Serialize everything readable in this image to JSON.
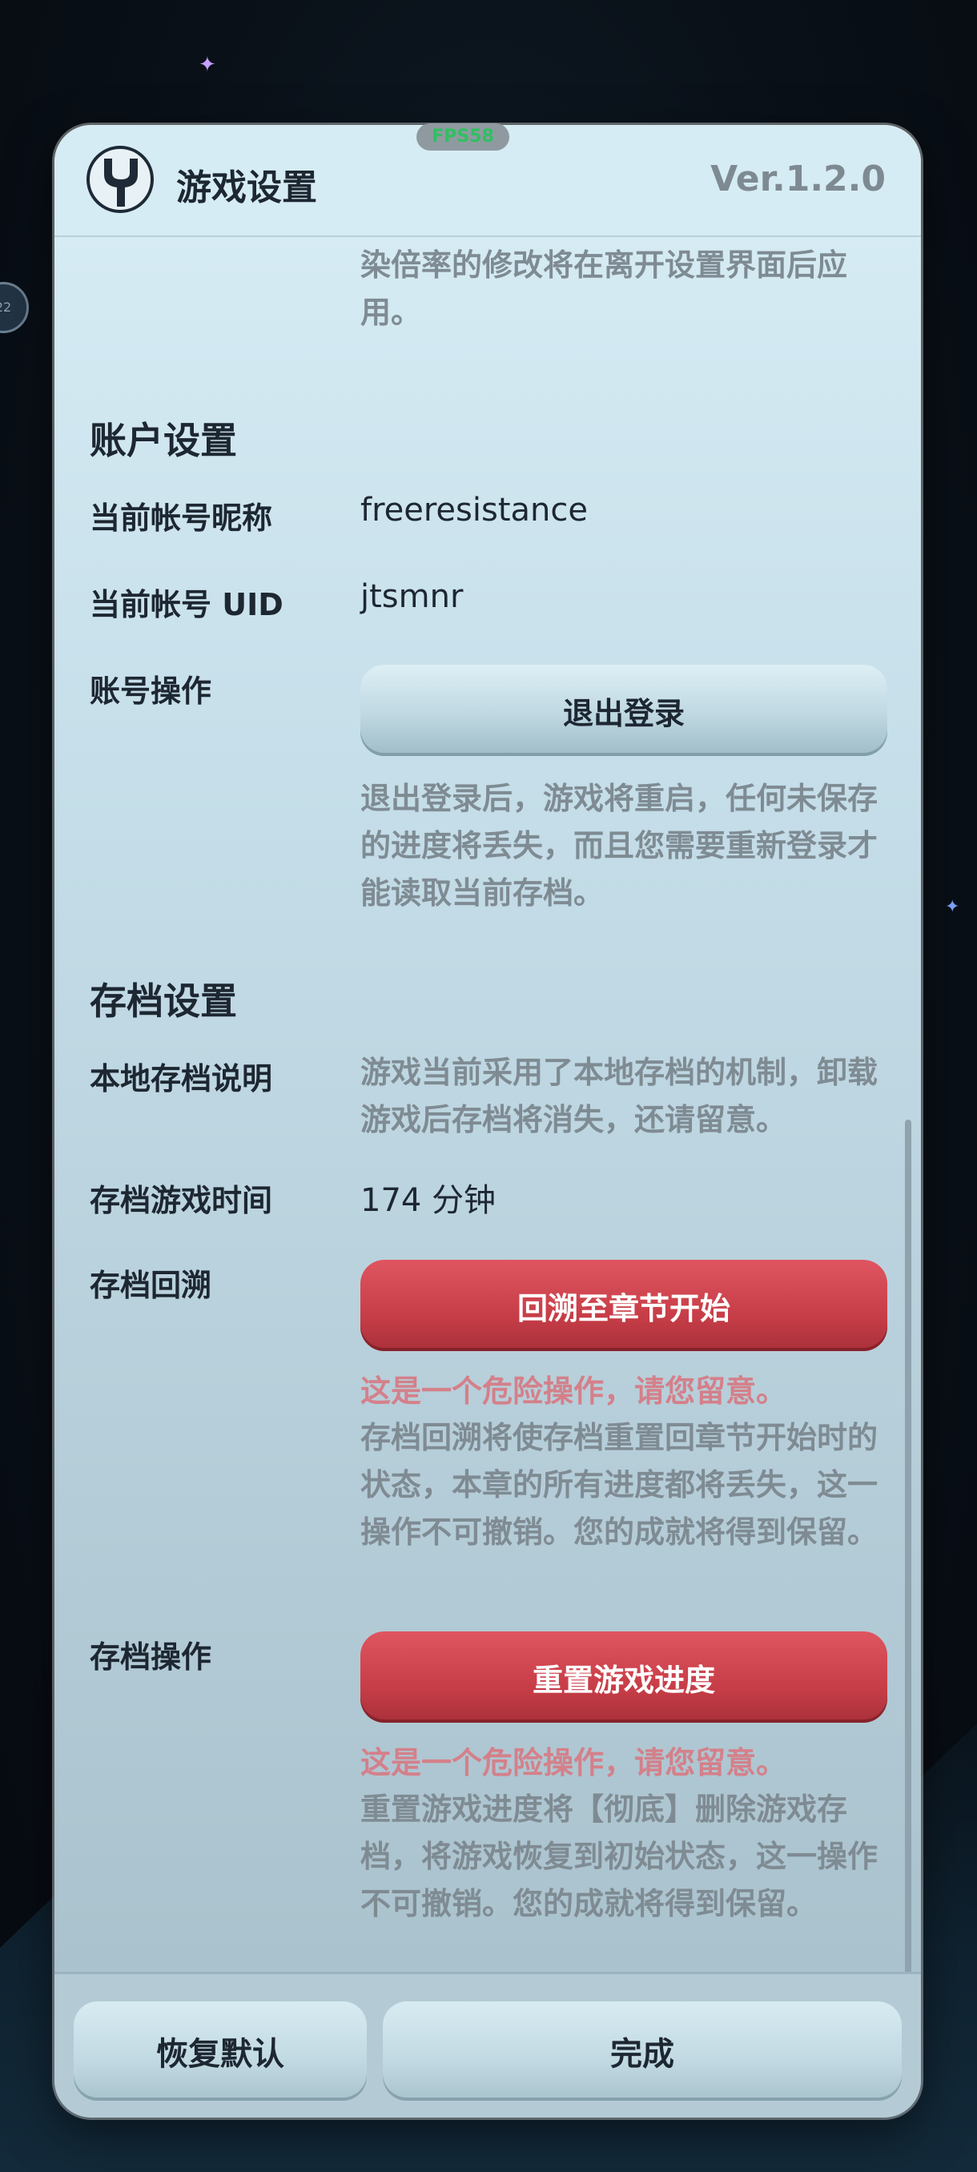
{
  "fps_label": "FPS58",
  "header": {
    "title": "游戏设置",
    "version": "Ver.1.2.0"
  },
  "render_note": "染倍率的修改将在离开设置界面后应用。",
  "account": {
    "section_title": "账户设置",
    "nickname_label": "当前帐号昵称",
    "nickname_value": "freeresistance",
    "uid_label": "当前帐号 UID",
    "uid_value": "jtsmnr",
    "ops_label": "账号操作",
    "logout_button": "退出登录",
    "logout_note": "退出登录后，游戏将重启，任何未保存的进度将丢失，而且您需要重新登录才能读取当前存档。"
  },
  "save": {
    "section_title": "存档设置",
    "local_label": "本地存档说明",
    "local_note": "游戏当前采用了本地存档的机制，卸载游戏后存档将消失，还请留意。",
    "playtime_label": "存档游戏时间",
    "playtime_value": "174 分钟",
    "rollback_label": "存档回溯",
    "rollback_button": "回溯至章节开始",
    "rollback_warning": "这是一个危险操作，请您留意。",
    "rollback_note": "存档回溯将使存档重置回章节开始时的状态，本章的所有进度都将丢失，这一操作不可撤销。您的成就将得到保留。",
    "ops_label": "存档操作",
    "reset_button": "重置游戏进度",
    "reset_warning": "这是一个危险操作，请您留意。",
    "reset_note": "重置游戏进度将【彻底】删除游戏存档，将游戏恢复到初始状态，这一操作不可撤销。您的成就将得到保留。"
  },
  "footer": {
    "restore_button": "恢复默认",
    "done_button": "完成"
  },
  "colors": {
    "danger": "#c83e48",
    "warning_text": "#d4808a",
    "fps_text": "#2fc060"
  }
}
